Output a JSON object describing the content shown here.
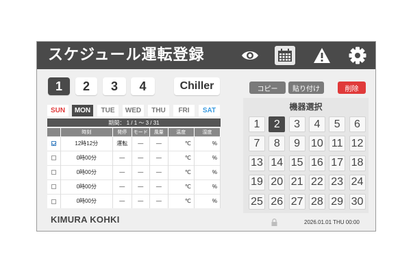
{
  "header": {
    "title": "スケジュール運転登録",
    "icons": [
      "eye-icon",
      "calendar-icon",
      "warning-icon",
      "gear-icon"
    ]
  },
  "tabs": [
    {
      "label": "1",
      "active": true
    },
    {
      "label": "2",
      "active": false
    },
    {
      "label": "3",
      "active": false
    },
    {
      "label": "4",
      "active": false
    },
    {
      "label": "Chiller",
      "active": false
    }
  ],
  "days": [
    {
      "label": "SUN",
      "kind": "sun",
      "active": false
    },
    {
      "label": "MON",
      "kind": "weekday",
      "active": true
    },
    {
      "label": "TUE",
      "kind": "weekday",
      "active": false
    },
    {
      "label": "WED",
      "kind": "weekday",
      "active": false
    },
    {
      "label": "THU",
      "kind": "weekday",
      "active": false
    },
    {
      "label": "FRI",
      "kind": "weekday",
      "active": false
    },
    {
      "label": "SAT",
      "kind": "sat",
      "active": false
    }
  ],
  "period": "期間： 1 / 1 〜 3 / 31",
  "table": {
    "headers": [
      "",
      "時刻",
      "発停",
      "モード",
      "風量",
      "温度",
      "湿度"
    ],
    "rows": [
      {
        "checked": true,
        "time": "12時12分",
        "onoff": "運転",
        "mode": "—",
        "fan": "—",
        "temp": "℃",
        "hum": "%"
      },
      {
        "checked": false,
        "time": "0時00分",
        "onoff": "—",
        "mode": "—",
        "fan": "—",
        "temp": "℃",
        "hum": "%"
      },
      {
        "checked": false,
        "time": "0時00分",
        "onoff": "—",
        "mode": "—",
        "fan": "—",
        "temp": "℃",
        "hum": "%"
      },
      {
        "checked": false,
        "time": "0時00分",
        "onoff": "—",
        "mode": "—",
        "fan": "—",
        "temp": "℃",
        "hum": "%"
      },
      {
        "checked": false,
        "time": "0時00分",
        "onoff": "—",
        "mode": "—",
        "fan": "—",
        "temp": "℃",
        "hum": "%"
      }
    ]
  },
  "actions": {
    "copy": "コピー",
    "paste": "貼り付け",
    "delete": "削除"
  },
  "machines": {
    "title": "機器選択",
    "items": [
      "1",
      "2",
      "3",
      "4",
      "5",
      "6",
      "7",
      "8",
      "9",
      "10",
      "11",
      "12",
      "13",
      "14",
      "15",
      "16",
      "17",
      "18",
      "19",
      "20",
      "21",
      "22",
      "23",
      "24",
      "25",
      "26",
      "27",
      "28",
      "29",
      "30"
    ],
    "selected": "2"
  },
  "footer": {
    "brand": "KIMURA KOHKI",
    "datetime": "2026.01.01 THU 00:00"
  },
  "colors": {
    "header_bg": "#4a4a4a",
    "delete_red": "#e03a3a",
    "sun_red": "#e03a3a",
    "sat_blue": "#3a9be0",
    "check_blue": "#3a7fc1"
  }
}
